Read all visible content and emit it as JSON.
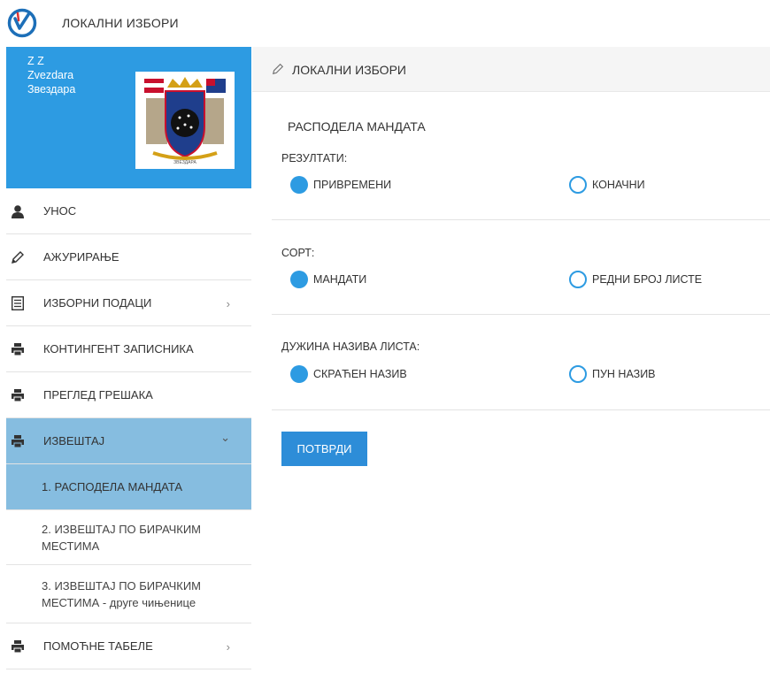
{
  "app": {
    "title": "ЛОКАЛНИ ИЗБОРИ",
    "logo_icon": "election-logo-icon"
  },
  "profile": {
    "line1": "Z Z",
    "line2": "Zvezdara",
    "line3": "Звездара",
    "crest_caption": "ЗВЕЗДАРА"
  },
  "sidebar": {
    "items": [
      {
        "label": "УНОС",
        "icon": "user-icon"
      },
      {
        "label": "АЖУРИРАЊЕ",
        "icon": "pencil-icon"
      },
      {
        "label": "ИЗБОРНИ ПОДАЦИ",
        "icon": "list-icon",
        "chevron": "›"
      },
      {
        "label": "КОНТИНГЕНТ ЗАПИСНИКА",
        "icon": "printer-icon"
      },
      {
        "label": "ПРЕГЛЕД ГРЕШАКА",
        "icon": "printer-icon"
      },
      {
        "label": "ИЗВЕШТАЈ",
        "icon": "printer-icon",
        "chevron": "⌄"
      },
      {
        "label": "ПОМОЋНЕ ТАБЕЛЕ",
        "icon": "printer-icon",
        "chevron": "›"
      }
    ],
    "subitems": [
      {
        "label": "1. РАСПОДЕЛА МАНДАТА"
      },
      {
        "label_l1": "2. ИЗВЕШТАЈ ПО БИРАЧКИМ",
        "label_l2": "МЕСТИМА"
      },
      {
        "label_l1": "3. ИЗВЕШТАЈ ПО БИРАЧКИМ",
        "label_l2": "МЕСТИМА - друге чињенице"
      }
    ]
  },
  "main": {
    "header": "ЛОКАЛНИ ИЗБОРИ",
    "panel_title": "РАСПОДЕЛА МАНДАТА",
    "groups": [
      {
        "label": "РЕЗУЛТАТИ:",
        "options": [
          "ПРИВРЕМЕНИ",
          "КОНАЧНИ"
        ],
        "selected": 0
      },
      {
        "label": "СОРТ:",
        "options": [
          "МАНДАТИ",
          "РЕДНИ БРОЈ ЛИСТЕ"
        ],
        "selected": 0
      },
      {
        "label": "ДУЖИНА НАЗИВА ЛИСТА:",
        "options": [
          "СКРАЋЕН НАЗИВ",
          "ПУН НАЗИВ"
        ],
        "selected": 0
      }
    ],
    "submit_label": "ПОТВРДИ"
  },
  "colors": {
    "accent": "#2d9be2",
    "active_bg": "#86bde0",
    "button": "#2d8dd8"
  }
}
